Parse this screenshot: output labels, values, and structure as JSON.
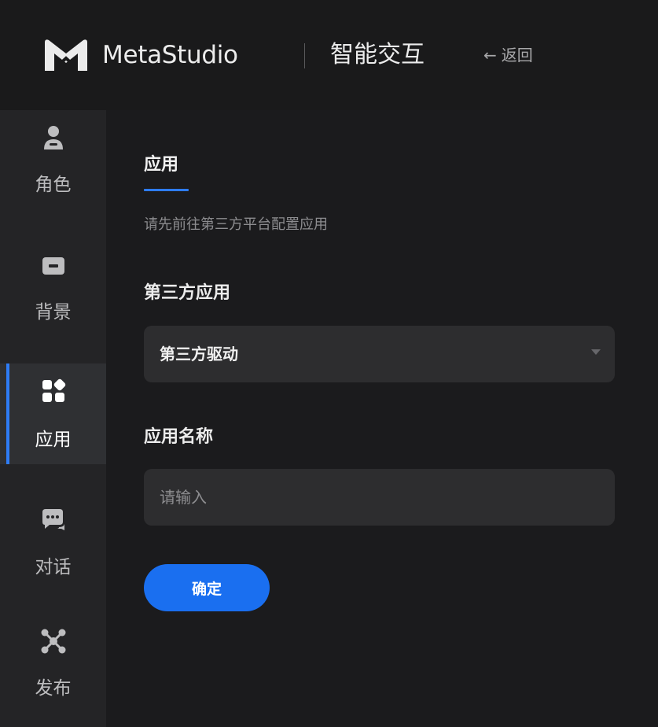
{
  "header": {
    "brand": "MetaStudio",
    "section": "智能交互",
    "back_arrow": "←",
    "back_label": "返回"
  },
  "sidebar": {
    "items": [
      {
        "label": "角色",
        "icon": "user-icon"
      },
      {
        "label": "背景",
        "icon": "image-icon"
      },
      {
        "label": "应用",
        "icon": "apps-icon",
        "active": true
      },
      {
        "label": "对话",
        "icon": "chat-icon"
      },
      {
        "label": "发布",
        "icon": "publish-icon"
      }
    ]
  },
  "main": {
    "tab": "应用",
    "hint": "请先前往第三方平台配置应用",
    "third_party_label": "第三方应用",
    "third_party_value": "第三方驱动",
    "app_name_label": "应用名称",
    "app_name_placeholder": "请输入",
    "app_name_value": "",
    "confirm_label": "确定"
  },
  "colors": {
    "accent": "#2e7cf6",
    "button": "#1a6ff0",
    "background": "#1b1b1d",
    "sidebar": "#242426",
    "field": "#2d2d2f"
  }
}
